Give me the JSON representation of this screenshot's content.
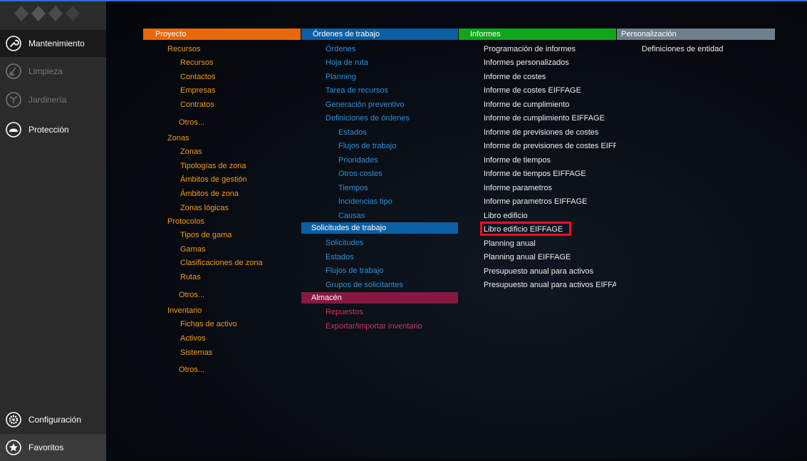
{
  "sidebar": {
    "items": [
      {
        "label": "Mantenimiento",
        "icon": "wrench-icon"
      },
      {
        "label": "Limpieza",
        "icon": "broom-icon"
      },
      {
        "label": "Jardinería",
        "icon": "plant-icon"
      },
      {
        "label": "Protección",
        "icon": "helmet-icon"
      }
    ],
    "bottom": [
      {
        "label": "Configuración",
        "icon": "gear-icon"
      },
      {
        "label": "Favoritos",
        "icon": "star-icon"
      }
    ]
  },
  "columns": {
    "proyecto": {
      "header": "Proyecto",
      "color": "#e8680b",
      "items": [
        "Recursos",
        "Recursos",
        "Contactos",
        "Empresas",
        "Contratos",
        "Otros...",
        "Zonas",
        "Zonas",
        "Tipologías de zona",
        "Ámbitos de gestión",
        "Ámbitos de zona",
        "Zonas lógicas",
        "Protocolos",
        "Tipos de gama",
        "Gamas",
        "Clasificaciones de zona",
        "Rutas",
        "Otros...",
        "Inventario",
        "Fichas de activo",
        "Activos",
        "Sistemas",
        "Otros..."
      ]
    },
    "ordenes": {
      "header": "Órdenes de trabajo",
      "color": "#0b5fa5",
      "items": [
        "Órdenes",
        "Hoja de ruta",
        "Planning",
        "Tarea de recursos",
        "Generación preventivo",
        "Definiciones de órdenes",
        "Estados",
        "Flujos de trabajo",
        "Prioridades",
        "Otros costes",
        "Tiempos",
        "Incidencias tipo",
        "Causas"
      ],
      "solicitudes_header": "Solicitudes de trabajo",
      "solicitudes": [
        "Solicitudes",
        "Estados",
        "Flujos de trabajo",
        "Grupos de solicitantes"
      ],
      "almacen_header": "Almacén",
      "almacen_color": "#8a1741",
      "almacen": [
        "Repuestos",
        "Exportar/importar inventario"
      ]
    },
    "informes": {
      "header": "Informes",
      "color": "#11a619",
      "items": [
        "Programación de informes",
        "Informes personalizados",
        "Informe de costes",
        "Informe de costes EIFFAGE",
        "Informe de cumplimiento",
        "Informe de cumplimiento EIFFAGE",
        "Informe de previsiones de costes",
        "Informe de previsiones de costes EIFF",
        "Informe de tiempos",
        "Informe de tiempos EIFFAGE",
        "Informe parametros",
        "Informe parametros EIFFAGE",
        "Libro edificio",
        "Libro edificio EIFFAGE",
        "Planning anual",
        "Planning anual EIFFAGE",
        "Presupuesto anual para activos",
        "Presupuesto anual para activos EIFFA"
      ]
    },
    "personalizacion": {
      "header": "Personalización",
      "color": "#6f7f8c",
      "items": [
        "Definiciones de entidad"
      ]
    }
  }
}
